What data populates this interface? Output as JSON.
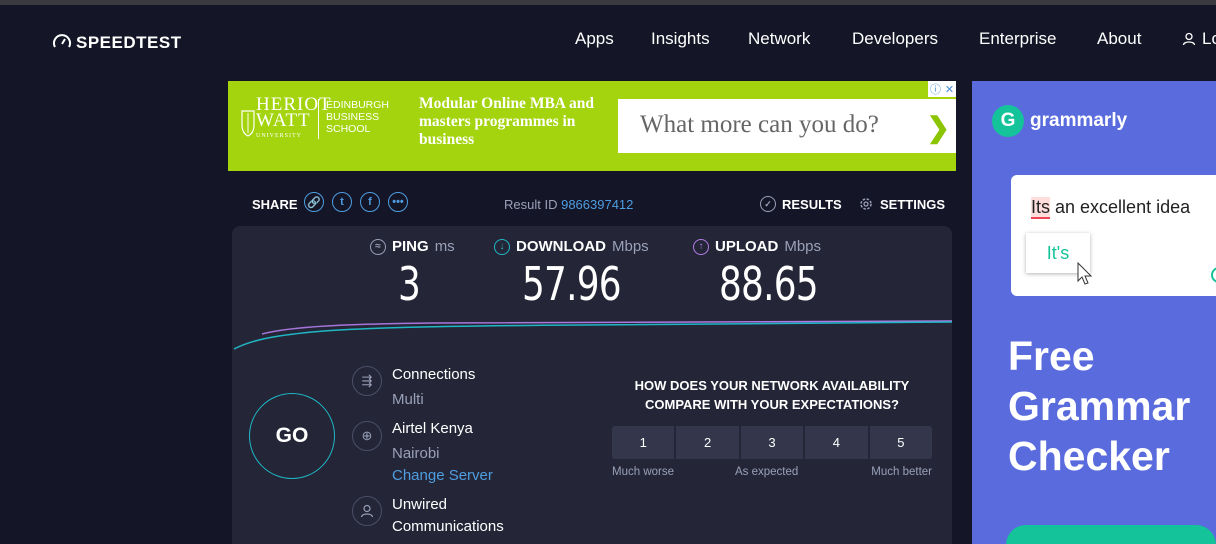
{
  "nav": {
    "logo": "SPEEDTEST",
    "links": [
      "Apps",
      "Insights",
      "Network",
      "Developers",
      "Enterprise",
      "About"
    ],
    "login": "Lo"
  },
  "ad_top": {
    "brand_line1": "HERIOT",
    "brand_line2": "WATT",
    "brand_university": "UNIVERSITY",
    "school": "EDINBURGH BUSINESS SCHOOL",
    "tagline": "Modular Online MBA and masters programmes in business",
    "cta": "What more can you do?"
  },
  "share": {
    "label": "SHARE",
    "result_id_label": "Result ID",
    "result_id": "9866397412",
    "results_label": "RESULTS",
    "settings_label": "SETTINGS"
  },
  "metrics": {
    "ping": {
      "label": "PING",
      "unit": "ms",
      "value": "3"
    },
    "download": {
      "label": "DOWNLOAD",
      "unit": "Mbps",
      "value": "57.96"
    },
    "upload": {
      "label": "UPLOAD",
      "unit": "Mbps",
      "value": "88.65"
    }
  },
  "go_label": "GO",
  "connections": {
    "title": "Connections",
    "value": "Multi"
  },
  "server": {
    "isp": "Airtel Kenya",
    "city": "Nairobi",
    "change": "Change Server"
  },
  "host": {
    "name_line1": "Unwired",
    "name_line2": "Communications"
  },
  "survey": {
    "question": "HOW DOES YOUR NETWORK AVAILABILITY COMPARE WITH YOUR EXPECTATIONS?",
    "options": [
      "1",
      "2",
      "3",
      "4",
      "5"
    ],
    "label_low": "Much worse",
    "label_mid": "As expected",
    "label_high": "Much better"
  },
  "ad_side": {
    "brand": "grammarly",
    "sentence_its": "Its",
    "sentence_rest": " an excellent idea",
    "suggestion": "It's",
    "headline_1": "Free",
    "headline_2": "Grammar",
    "headline_3": "Checker"
  },
  "colors": {
    "background": "#141526",
    "panel": "#242637",
    "accent_blue": "#4e9de0",
    "download_cyan": "#1fb7c4",
    "upload_purple": "#b27ce8",
    "ad_green": "#a3d40e",
    "grammarly_blue": "#5a6bdd",
    "grammarly_green": "#15c39a"
  }
}
